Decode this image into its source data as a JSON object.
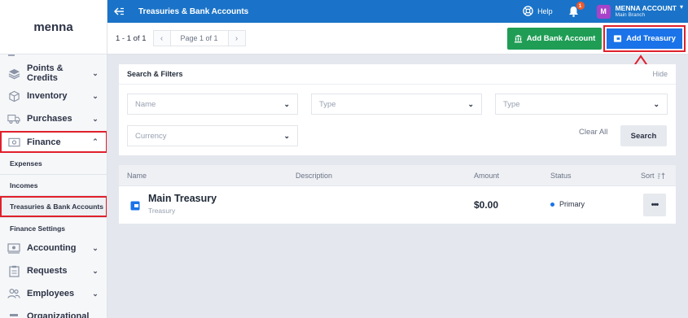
{
  "brand": {
    "name": "menna"
  },
  "sidebar": {
    "items": [
      {
        "label": "Points & Credits",
        "icon": "layers-icon"
      },
      {
        "label": "Inventory",
        "icon": "box-icon"
      },
      {
        "label": "Purchases",
        "icon": "truck-icon"
      },
      {
        "label": "Finance",
        "icon": "cash-icon"
      },
      {
        "label": "Accounting",
        "icon": "money-icon"
      },
      {
        "label": "Requests",
        "icon": "clipboard-icon"
      },
      {
        "label": "Employees",
        "icon": "people-icon"
      },
      {
        "label": "Organizational",
        "icon": "org-icon"
      }
    ],
    "finance_sub": [
      {
        "label": "Expenses"
      },
      {
        "label": "Incomes"
      },
      {
        "label": "Treasuries & Bank Accounts"
      },
      {
        "label": "Finance Settings"
      }
    ]
  },
  "topbar": {
    "title": "Treasuries & Bank Accounts",
    "help": "Help",
    "notifications": "1",
    "avatar_letter": "M",
    "account_name": "MENNA ACCOUNT",
    "account_branch": "Main Branch",
    "bg_color": "#1a73c8"
  },
  "toolbar": {
    "range": "1 - 1 of 1",
    "page_label": "Page 1 of 1",
    "add_bank_label": "Add Bank Account",
    "add_treasury_label": "Add Treasury"
  },
  "filters": {
    "title": "Search & Filters",
    "hide": "Hide",
    "name_placeholder": "Name",
    "type1_placeholder": "Type",
    "type2_placeholder": "Type",
    "currency_placeholder": "Currency",
    "clear_all": "Clear All",
    "search": "Search"
  },
  "table": {
    "columns": {
      "name": "Name",
      "description": "Description",
      "amount": "Amount",
      "status": "Status",
      "sort": "Sort"
    },
    "rows": [
      {
        "name": "Main Treasury",
        "type": "Treasury",
        "description": "",
        "amount": "$0.00",
        "status": "Primary",
        "status_color": "#1a73e8"
      }
    ]
  }
}
